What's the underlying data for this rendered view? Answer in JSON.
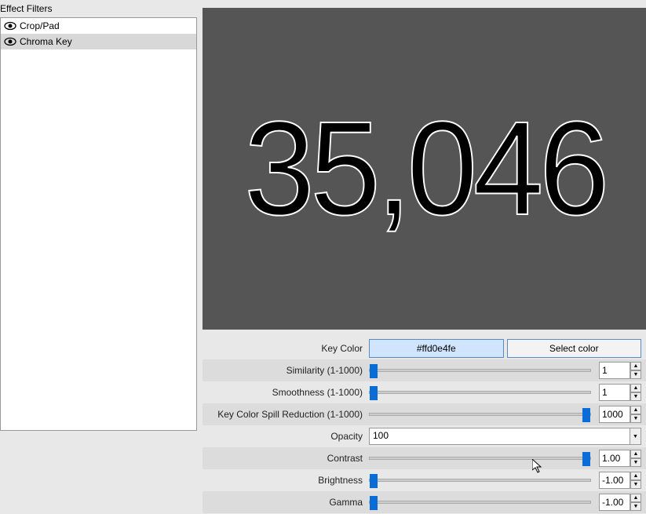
{
  "sidebar": {
    "title": "Effect Filters",
    "items": [
      {
        "label": "Crop/Pad",
        "selected": false
      },
      {
        "label": "Chroma Key",
        "selected": true
      }
    ]
  },
  "preview": {
    "text": "35,046"
  },
  "properties": {
    "key_color": {
      "label": "Key Color",
      "value": "#ffd0e4fe",
      "button": "Select color"
    },
    "similarity": {
      "label": "Similarity (1-1000)",
      "value": "1",
      "pos": 0
    },
    "smoothness": {
      "label": "Smoothness (1-1000)",
      "value": "1",
      "pos": 0
    },
    "spill": {
      "label": "Key Color Spill Reduction (1-1000)",
      "value": "1000",
      "pos": 100
    },
    "opacity": {
      "label": "Opacity",
      "value": "100"
    },
    "contrast": {
      "label": "Contrast",
      "value": "1.00",
      "pos": 100
    },
    "brightness": {
      "label": "Brightness",
      "value": "-1.00",
      "pos": 0
    },
    "gamma": {
      "label": "Gamma",
      "value": "-1.00",
      "pos": 0
    }
  }
}
